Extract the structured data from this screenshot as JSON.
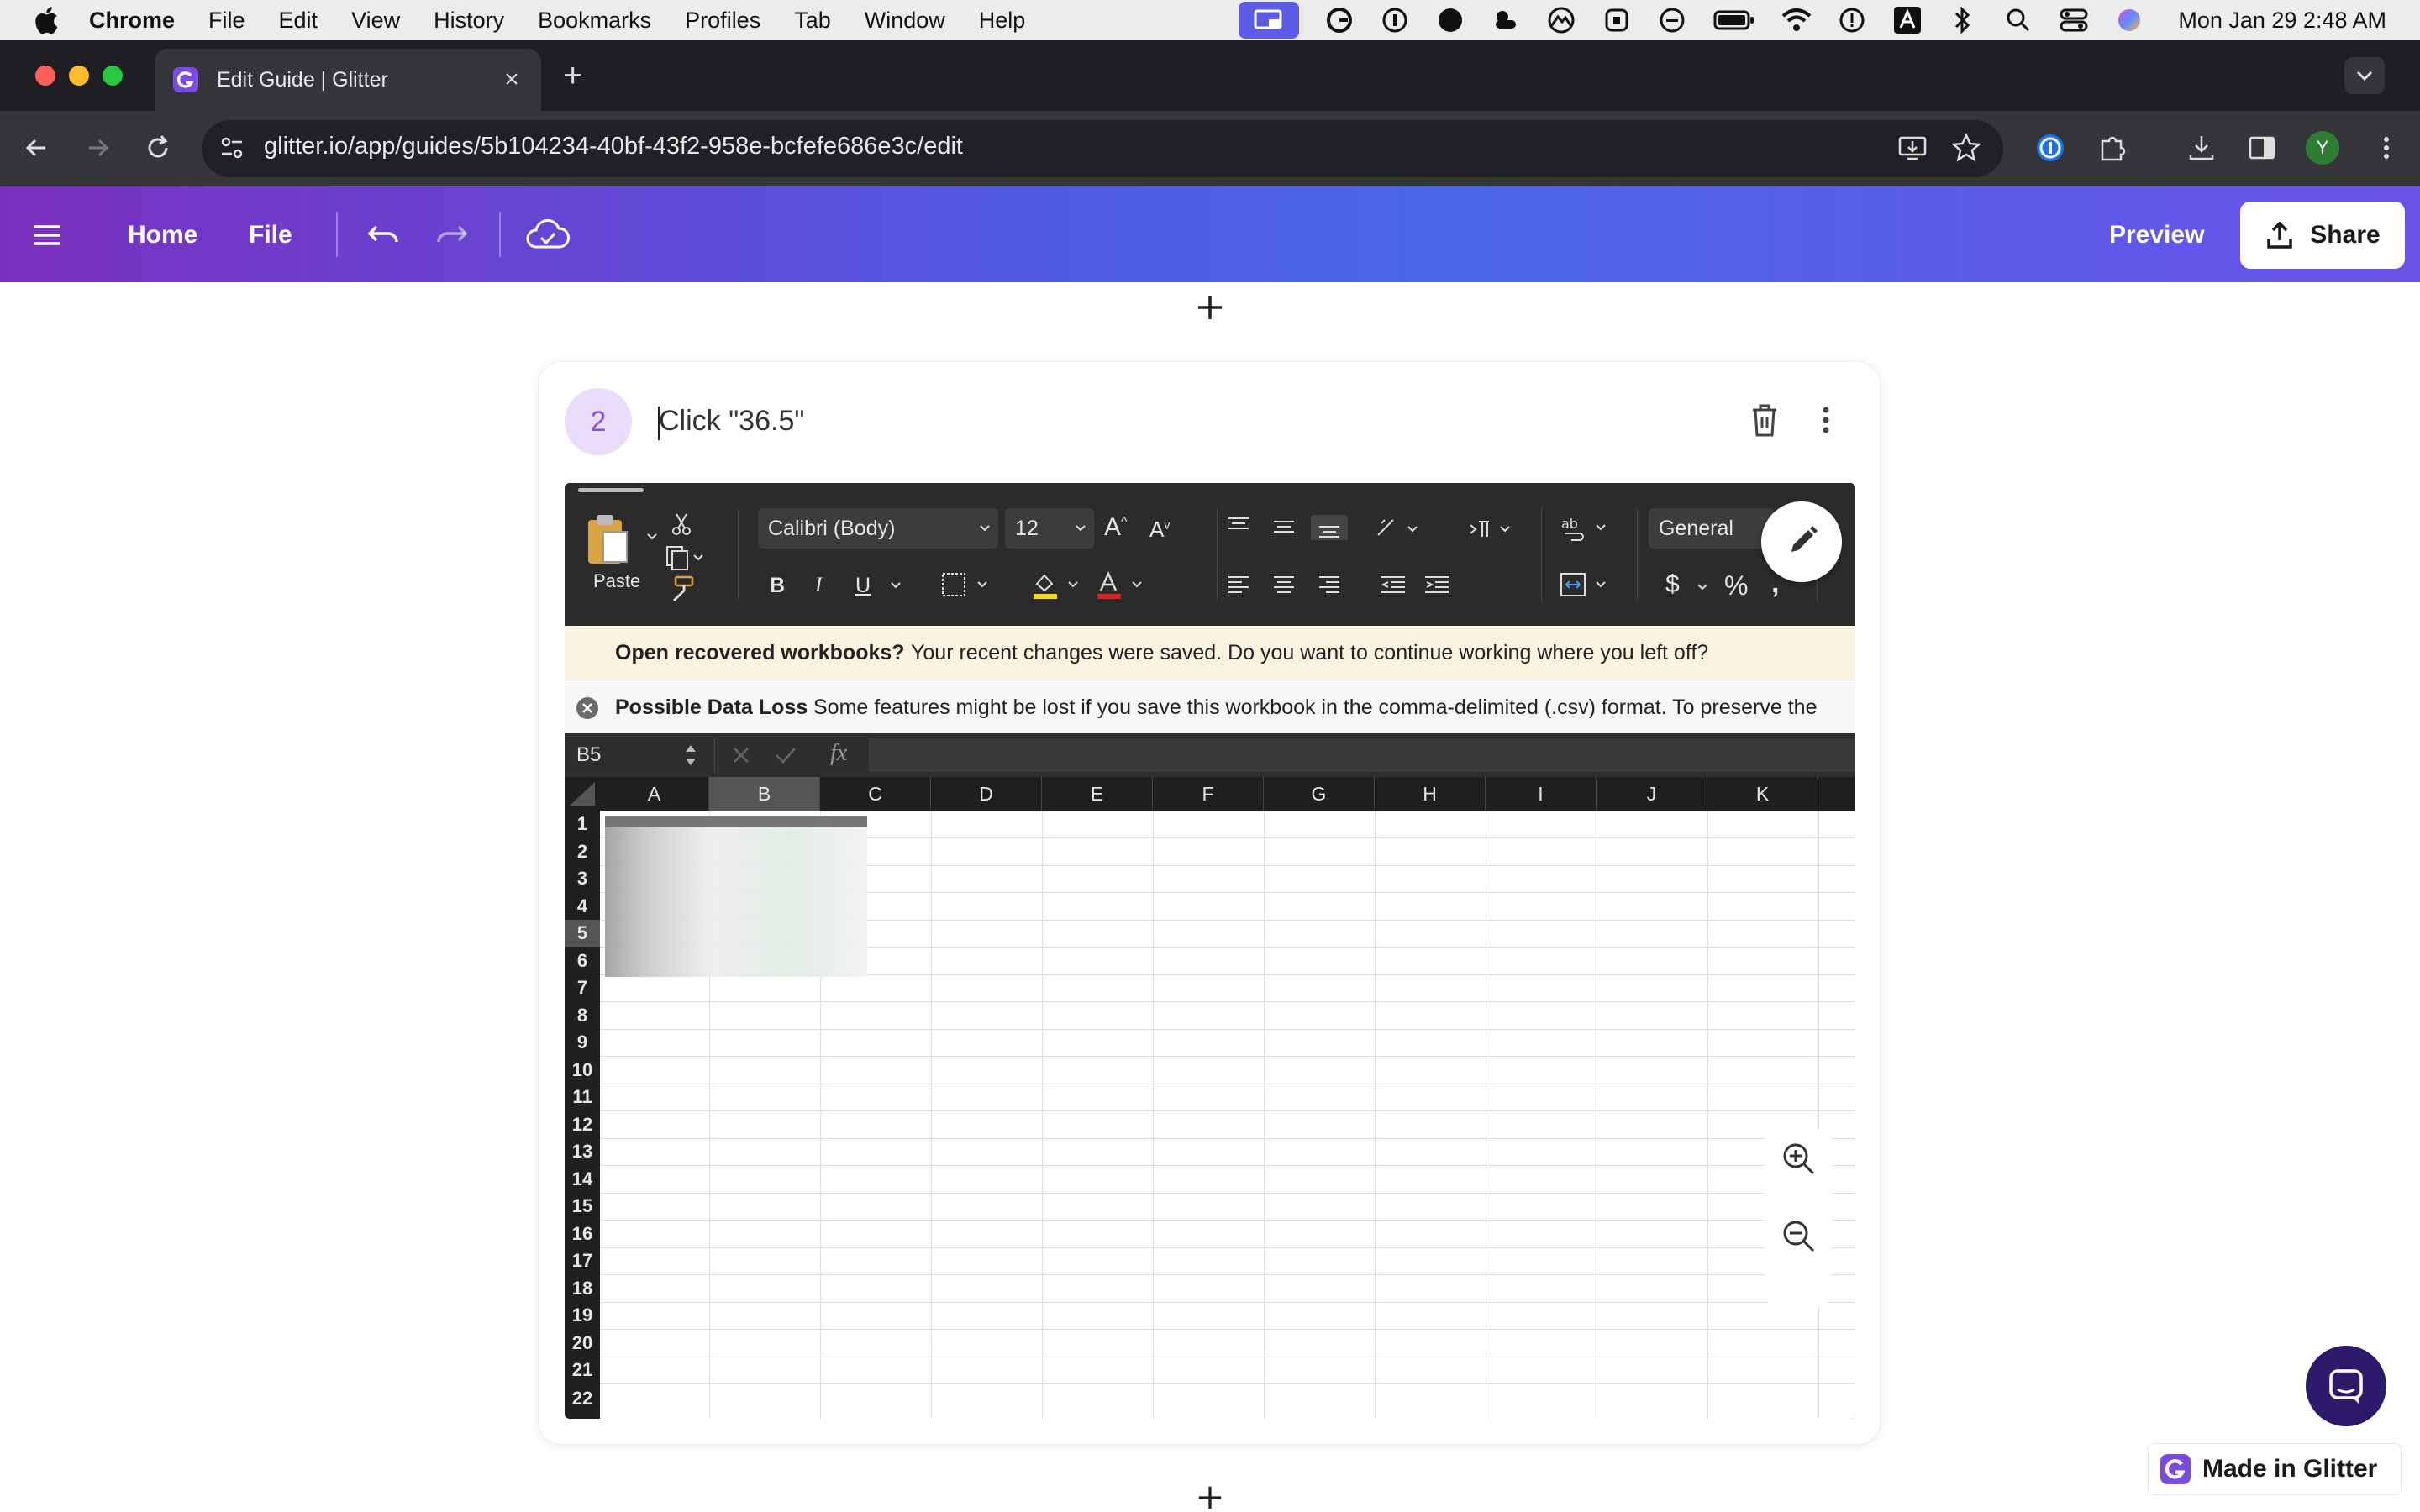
{
  "menubar": {
    "app_name": "Chrome",
    "items": [
      "File",
      "Edit",
      "View",
      "History",
      "Bookmarks",
      "Profiles",
      "Tab",
      "Window",
      "Help"
    ],
    "clock": "Mon Jan 29  2:48 AM"
  },
  "browser": {
    "tab_title": "Edit Guide | Glitter",
    "url": "glitter.io/app/guides/5b104234-40bf-43f2-958e-bcfefe686e3c/edit",
    "profile_initial": "Y"
  },
  "app": {
    "home_label": "Home",
    "file_label": "File",
    "preview_label": "Preview",
    "share_label": "Share",
    "accent_colors": [
      "#7b2fc0",
      "#4f5ce6",
      "#6a52e8"
    ]
  },
  "step": {
    "number": "2",
    "title": "Click \"36.5\""
  },
  "screenshot": {
    "paste_label": "Paste",
    "font_name": "Calibri (Body)",
    "font_size": "12",
    "number_format": "General",
    "recover_title": "Open recovered workbooks?",
    "recover_text": "Your recent changes were saved. Do you want to continue working where you left off?",
    "dataloss_title": "Possible Data Loss",
    "dataloss_text": "Some features might be lost if you save this workbook in the comma-delimited (.csv) format. To preserve the",
    "name_box": "B5",
    "fx_label": "fx",
    "columns": [
      "A",
      "B",
      "C",
      "D",
      "E",
      "F",
      "G",
      "H",
      "I",
      "J",
      "K"
    ],
    "rows": [
      "1",
      "2",
      "3",
      "4",
      "5",
      "6",
      "7",
      "8",
      "9",
      "10",
      "11",
      "12",
      "13",
      "14",
      "15",
      "16",
      "17",
      "18",
      "19",
      "20",
      "21",
      "22"
    ],
    "selected_column": "B",
    "selected_row": "5"
  },
  "footer": {
    "made_in": "Made in Glitter"
  }
}
